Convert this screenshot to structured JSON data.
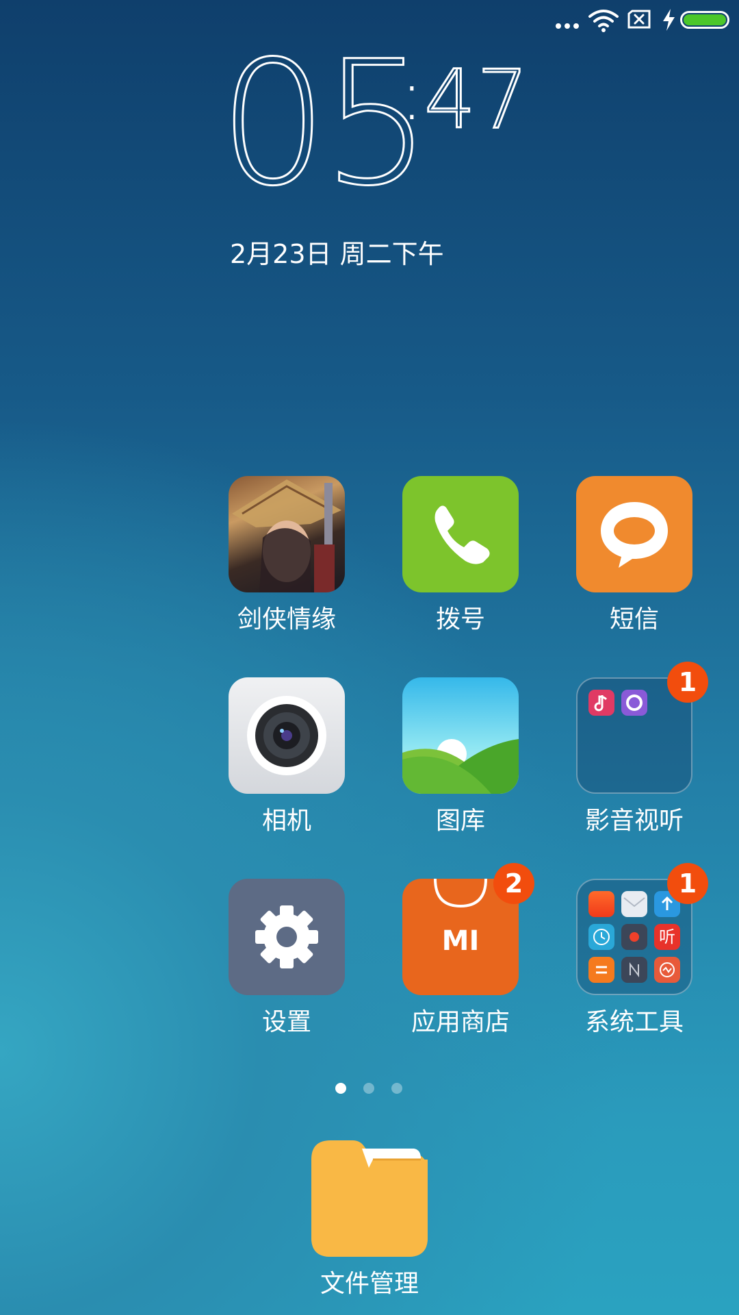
{
  "status_bar": {
    "icons": [
      "more-dots-icon",
      "wifi-icon",
      "no-sim-icon",
      "charging-bolt-icon",
      "battery-icon"
    ],
    "battery_level": 1.0,
    "battery_color": "#4cc72a"
  },
  "clock": {
    "hours": "05",
    "colon": ":",
    "minutes": "47"
  },
  "date": "2月23日 周二下午",
  "apps": {
    "jianxia": {
      "label": "剑侠情缘"
    },
    "dialer": {
      "label": "拨号",
      "color": "#7dc42c"
    },
    "messages": {
      "label": "短信",
      "color": "#f08a2e"
    },
    "camera": {
      "label": "相机"
    },
    "gallery": {
      "label": "图库"
    },
    "media_folder": {
      "label": "影音视听",
      "badge": "1",
      "mini_icons": [
        "music-icon",
        "video-icon"
      ]
    },
    "settings": {
      "label": "设置",
      "color": "#5d6b85"
    },
    "app_store": {
      "label": "应用商店",
      "badge": "2",
      "logo": "MI",
      "color": "#e8661d"
    },
    "tools_folder": {
      "label": "系统工具",
      "badge": "1",
      "mini_icons": [
        "mi-community-icon",
        "mail-icon",
        "updater-icon",
        "clock-icon",
        "recorder-icon",
        "listen-icon",
        "calculator-icon",
        "notes-icon",
        "security-icon"
      ],
      "listen_text": "听"
    }
  },
  "page_indicator": {
    "count": 3,
    "active": 1
  },
  "dock": {
    "file_manager": {
      "label": "文件管理",
      "color": "#f9b845"
    }
  },
  "badge_color": "#f24d0d"
}
